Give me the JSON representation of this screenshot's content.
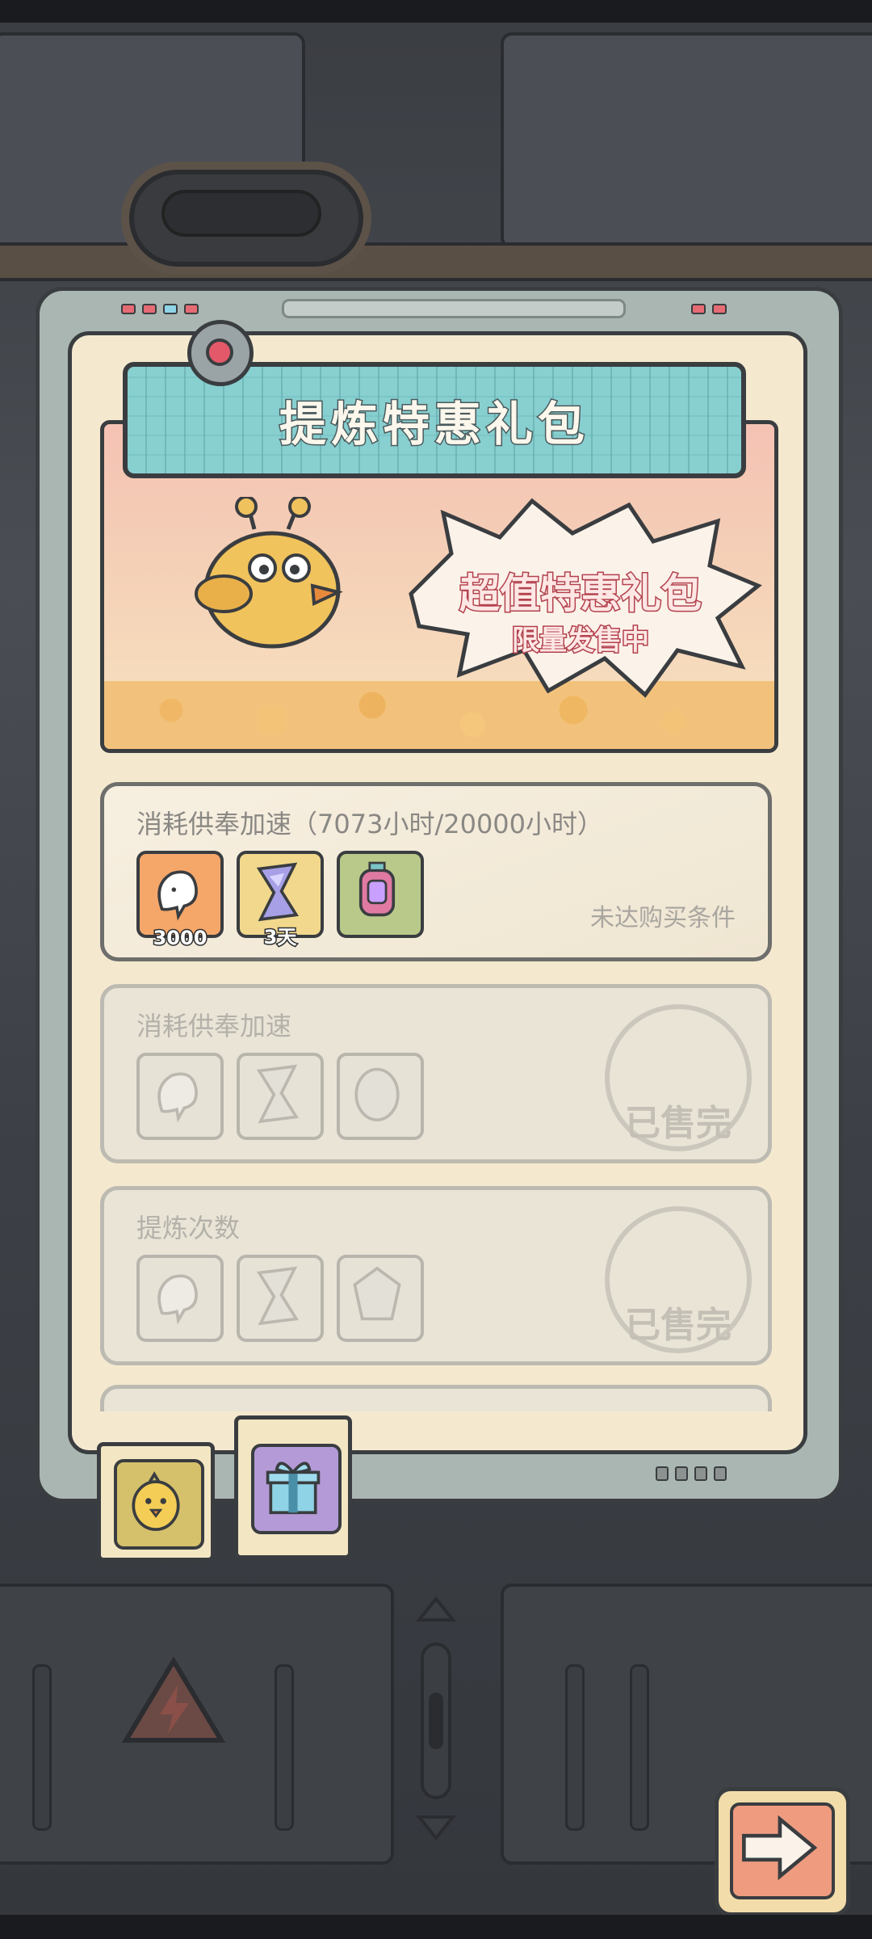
{
  "title": "提炼特惠礼包",
  "banner": {
    "headline": "超值特惠礼包",
    "subline": "限量发售中"
  },
  "packs": [
    {
      "title": "消耗供奉加速（7073小时/20000小时）",
      "status": "未达购买条件",
      "items": [
        {
          "icon": "ghost-token-icon",
          "qty": "3000",
          "bg": "#f5a76a"
        },
        {
          "icon": "hourglass-icon",
          "qty": "3天",
          "bg": "#f1d88c"
        },
        {
          "icon": "lantern-icon",
          "qty": "",
          "bg": "#b9c98a"
        }
      ]
    },
    {
      "title": "消耗供奉加速",
      "status": "已售完",
      "items": [
        {
          "icon": "ghost-token-icon",
          "qty": ""
        },
        {
          "icon": "hourglass-icon",
          "qty": ""
        },
        {
          "icon": "egg-relic-icon",
          "qty": ""
        }
      ]
    },
    {
      "title": "提炼次数",
      "status": "已售完",
      "items": [
        {
          "icon": "ghost-token-icon",
          "qty": ""
        },
        {
          "icon": "hourglass-icon",
          "qty": ""
        },
        {
          "icon": "crystal-icon",
          "qty": ""
        }
      ]
    }
  ],
  "tabs": [
    {
      "icon": "chick-icon",
      "selected": false
    },
    {
      "icon": "gift-box-icon",
      "selected": true
    }
  ],
  "colors": {
    "accent_red": "#b3414e",
    "panel_cream": "#f4e9cf",
    "teal": "#88cfd0"
  }
}
